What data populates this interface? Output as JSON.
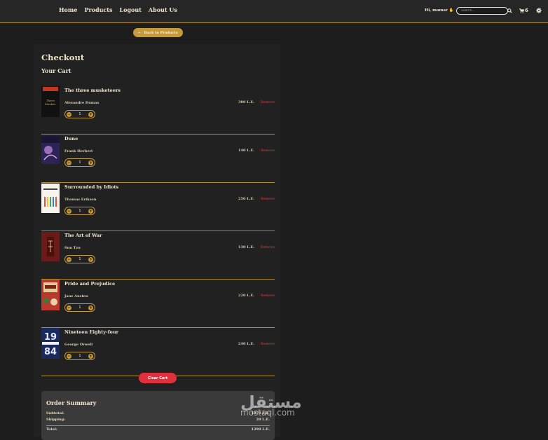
{
  "nav": {
    "links": [
      "Home",
      "Products",
      "Logout",
      "About Us"
    ],
    "greeting": "Hi, mamar",
    "search_placeholder": "Search...",
    "cart_count": "6"
  },
  "back_label": "Back to Products",
  "checkout": {
    "title": "Checkout",
    "subtitle": "Your Cart"
  },
  "cart": {
    "remove_label": "Remove",
    "items": [
      {
        "name": "The three musketeers",
        "author": "Alexandre Dumas",
        "price": "300 L.E.",
        "qty": "1"
      },
      {
        "name": "Dune",
        "author": "Frank Herbert",
        "price": "140 L.E.",
        "qty": "1"
      },
      {
        "name": "Surrounded by Idiots",
        "author": "Thomas Erikson",
        "price": "250 L.E.",
        "qty": "1"
      },
      {
        "name": "The Art of War",
        "author": "Sun Tzu",
        "price": "130 L.E.",
        "qty": "1"
      },
      {
        "name": "Pride and Prejudice",
        "author": "Jane Austen",
        "price": "220 L.E.",
        "qty": "1"
      },
      {
        "name": "Nineteen Eighty-four",
        "author": "George Orwell",
        "price": "240 L.E.",
        "qty": "1"
      }
    ]
  },
  "clear_label": "Clear Cart",
  "summary": {
    "title": "Order Summary",
    "subtotal_label": "Subtotal:",
    "subtotal": "1270 L.E.",
    "shipping_label": "Shipping:",
    "shipping": "20 L.E.",
    "total_label": "Total:",
    "total": "1290 L.E."
  },
  "watermark": {
    "arabic": "مستقل",
    "latin": "mostaql.com"
  },
  "colors": {
    "accent": "#c59a3c",
    "danger": "#e0303d",
    "background": "#1d1d1d"
  }
}
